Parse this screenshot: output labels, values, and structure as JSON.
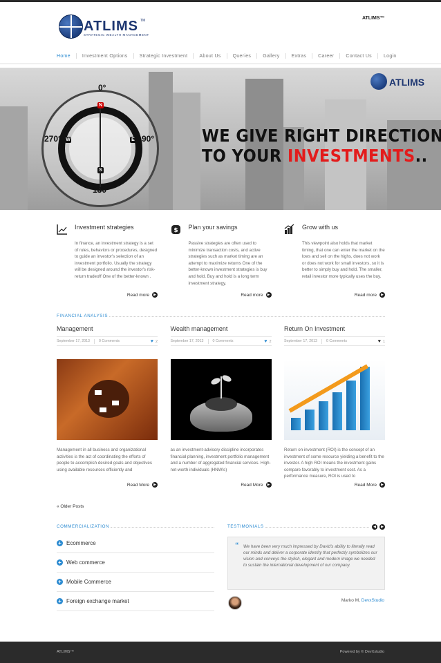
{
  "header": {
    "logo_name": "ATLIMS",
    "logo_tm": "TM",
    "logo_tagline": "STRATEGIC WEALTH MANAGEMENT",
    "brand_right": "ATLIMS™"
  },
  "nav": {
    "items": [
      "Home",
      "Investment Options",
      "Strategic Investment",
      "About Us",
      "Queries",
      "Gallery",
      "Extras",
      "Career",
      "Contact Us",
      "Login"
    ]
  },
  "hero": {
    "deg_top": "0°",
    "deg_left": "270°",
    "deg_right": "90°",
    "deg_bottom": "180°",
    "dir_n": "N",
    "dir_w": "W",
    "dir_e": "E",
    "dir_s": "S",
    "logo": "ATLIMS",
    "slogan_line1": "WE GIVE RIGHT DIRECTION",
    "slogan_line2_a": "TO YOUR ",
    "slogan_line2_b": "INVESTMENTS",
    "slogan_line2_c": ".."
  },
  "features": [
    {
      "icon": "chart-icon",
      "title": "Investment strategies",
      "text": "In finance, an investment strategy is a set of rules, behaviors or procedures, designed to guide an investor's selection of an investment portfolio. Usually the strategy will be designed around the investor's risk-return tradeoff One of the better-known .",
      "readmore": "Read more"
    },
    {
      "icon": "dollar-icon",
      "title": "Plan your savings",
      "text": "Passive strategies are often used to minimize transaction costs, and active strategies such as market timing are an attempt to maximize returns One of the better-known investment strategies is buy and hold. Buy and hold is a long term investment strategy.",
      "readmore": "Read more"
    },
    {
      "icon": "growth-icon",
      "title": "Grow with us",
      "text": "This viewpoint also holds that market timing, that one can enter the market on the lows and sell on the highs, does not work or does not work for small investors, so it is better to simply buy and hold. The smaller, retail investor more typically uses the buy.",
      "readmore": "Read more"
    }
  ],
  "financial_label": "FINANCIAL ANALYSIS",
  "posts": [
    {
      "title": "Management",
      "date": "September 17, 2013",
      "comments": "0 Comments",
      "likes": "2",
      "text": "Management in all business and organizational activities is the act of coordinating the efforts of people to accomplish desired goals and objectives using available resources efficiently and",
      "readmore": "Read More"
    },
    {
      "title": "Wealth management",
      "date": "September 17, 2013",
      "comments": "0 Comments",
      "likes": "2",
      "text": " as an investment-advisory discipline incorporates financial planning, investment portfolio management and a number of aggregated financial services. High-net-worth individuals (HNWIs)",
      "readmore": "Read More"
    },
    {
      "title": "Return On Investment",
      "date": "September 17, 2013",
      "comments": "0 Comments",
      "likes": "1",
      "text": "Return on investment (ROI) is the concept of an investment of some resource yielding a benefit to the investor. A high ROI means the investment gains compare favorably to investment cost. As a performance measure, ROI is used to",
      "readmore": "Read More"
    }
  ],
  "older_posts": "« Older Posts",
  "commercialization": {
    "label": "COMMERCIALIZATION",
    "items": [
      "Ecommerce",
      "Web commerce",
      "Mobile Commerce",
      "Foreign exchange market"
    ]
  },
  "testimonials": {
    "label": "TESTIMONIALS",
    "quote": "We have been very much impressed by David's ability to literally read our minds and deliver a corporate identity that perfectly symbolizes our vision and conveys the stylish, elegant and modern image we needed to sustain the international development of our company.",
    "author": "Marko M, ",
    "company": "DevxStudio"
  },
  "footer": {
    "left": "ATLIMS™",
    "right": "Powered by © DevXstudio"
  },
  "colors": {
    "accent": "#2c8bd1",
    "slogan_red": "#e31b1b",
    "footer_bg": "#2b2b2b"
  }
}
